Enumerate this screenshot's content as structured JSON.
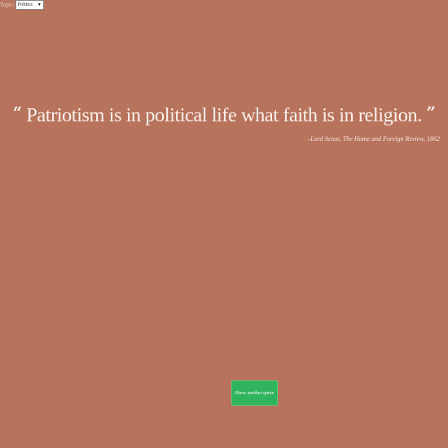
{
  "topic": {
    "label": "Topic:",
    "selected": "Politics",
    "caret": "▼"
  },
  "quote": {
    "open_mark": "“",
    "text": "Patriotism is in political life what faith is in religion.",
    "close_mark": "”",
    "attribution_prefix": "–Lord Acton, ",
    "source": "The Home and Foreign Review,",
    "year": " 1862"
  },
  "actions": {
    "new_quote_label": "Show another quote"
  },
  "colors": {
    "background": "#b8735c",
    "button": "#2fb35c"
  }
}
